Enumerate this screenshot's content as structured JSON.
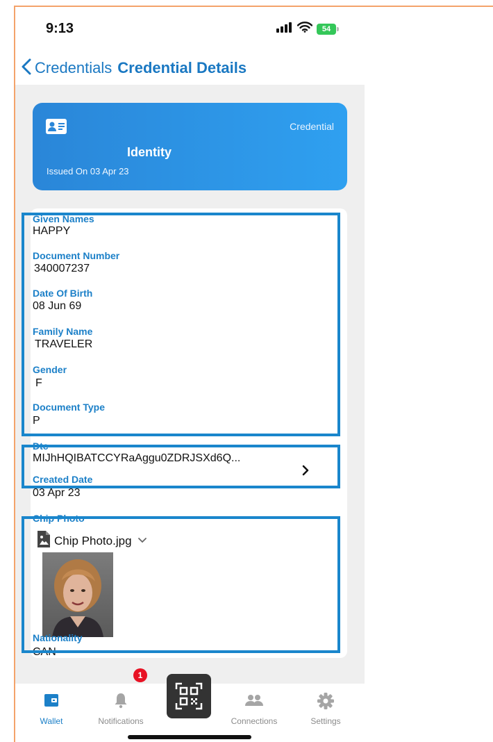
{
  "status_bar": {
    "time": "9:13",
    "battery": "54"
  },
  "nav": {
    "back_label": "Credentials",
    "title": "Credential Details"
  },
  "card": {
    "type_label": "Credential",
    "title": "Identity",
    "issued": "Issued On 03 Apr 23",
    "icon": "id-card-icon"
  },
  "fields": [
    {
      "label": "Given Names",
      "value": "HAPPY"
    },
    {
      "label": "Document Number",
      "value": "340007237"
    },
    {
      "label": "Date Of Birth",
      "value": "08 Jun 69"
    },
    {
      "label": "Family Name",
      "value": "TRAVELER"
    },
    {
      "label": "Gender",
      "value": "F"
    },
    {
      "label": "Document Type",
      "value": "P"
    },
    {
      "label": "Dtc",
      "value": "MIJhHQIBATCCYRaAggu0ZDRJSXd6Q..."
    },
    {
      "label": "Created Date",
      "value": "03 Apr 23"
    },
    {
      "label": "Chip Photo",
      "value": "Chip Photo.jpg"
    },
    {
      "label": "Nationality",
      "value": "CAN"
    }
  ],
  "tabs": [
    {
      "label": "Wallet",
      "icon": "wallet-icon",
      "active": true
    },
    {
      "label": "Notifications",
      "icon": "bell-icon",
      "badge": "1"
    },
    {
      "label": "",
      "icon": "qr-scan-icon"
    },
    {
      "label": "Connections",
      "icon": "people-icon"
    },
    {
      "label": "Settings",
      "icon": "gear-icon"
    }
  ],
  "colors": {
    "accent": "#1c80c8",
    "card_gradient_start": "#2a86d8",
    "card_gradient_end": "#2fa0f0",
    "highlight_border": "#1a86cc",
    "badge_red": "#e81224"
  }
}
